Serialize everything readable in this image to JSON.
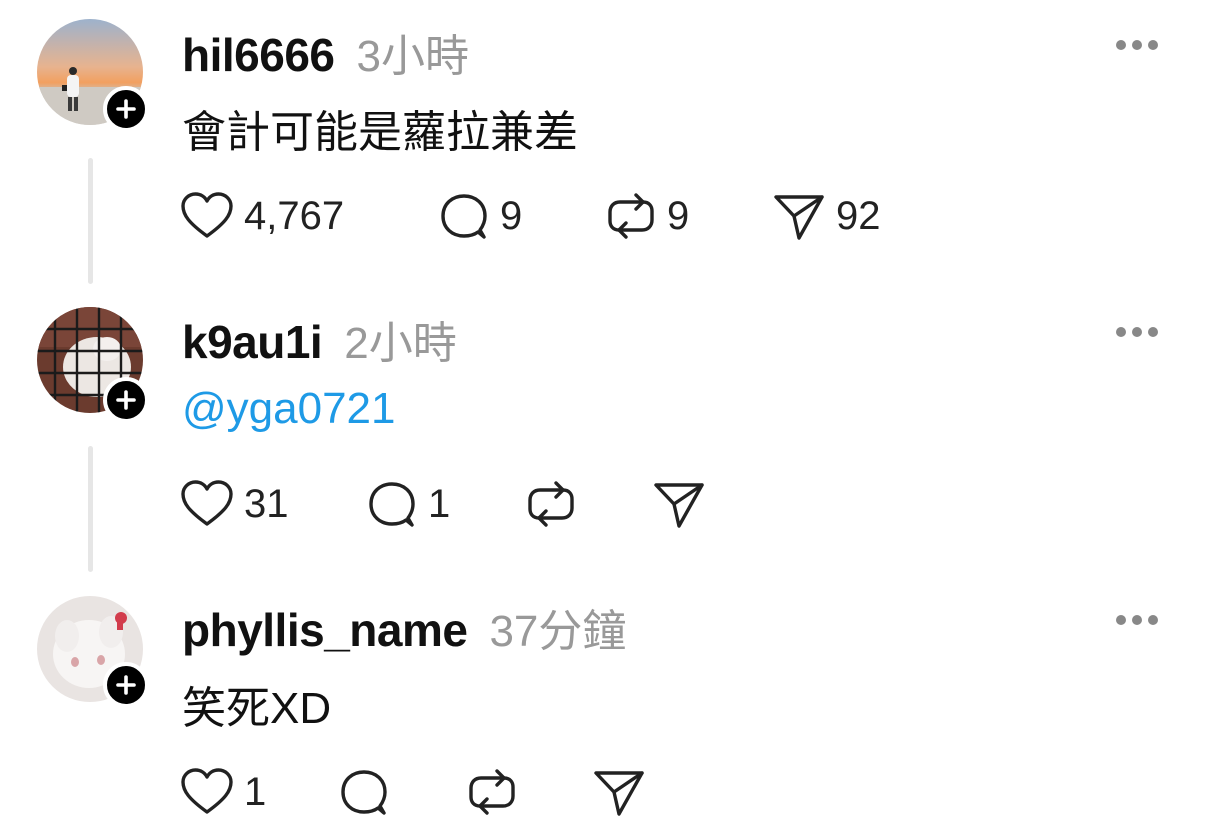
{
  "posts": [
    {
      "username": "hil6666",
      "time": "3小時",
      "content": "會計可能是蘿拉兼差",
      "likes": "4,767",
      "comments": "9",
      "reposts": "9",
      "shares": "92"
    },
    {
      "username": "k9au1i",
      "time": "2小時",
      "content": "@yga0721",
      "likes": "31",
      "comments": "1",
      "reposts": "",
      "shares": ""
    },
    {
      "username": "phyllis_name",
      "time": "37分鐘",
      "content": "笑死XD",
      "likes": "1",
      "comments": "",
      "reposts": "",
      "shares": ""
    }
  ],
  "colors": {
    "mention": "#1e9ae6",
    "time": "#999999",
    "thread_line": "#e6e6e6"
  },
  "icons": [
    "heart-icon",
    "comment-icon",
    "repost-icon",
    "share-icon",
    "more-icon",
    "plus-icon"
  ]
}
